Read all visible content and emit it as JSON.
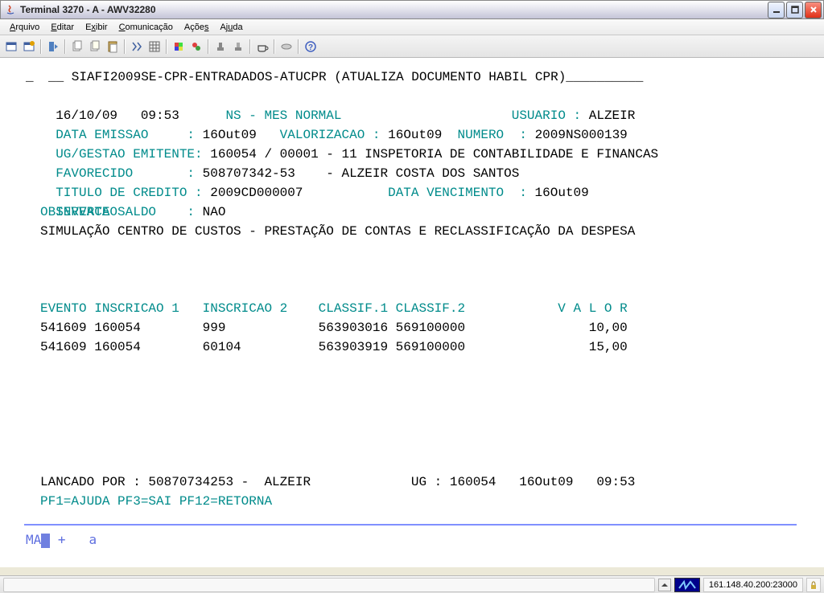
{
  "window": {
    "title": "Terminal 3270 - A - AWV32280"
  },
  "menu": {
    "arquivo": "Arquivo",
    "editar": "Editar",
    "exibir": "Exibir",
    "comunicacao": "Comunicação",
    "acoes": "Ações",
    "ajuda": "Ajuda"
  },
  "screen": {
    "breadcrumb": "__ SIAFI2009SE-CPR-ENTRADADOS-ATUCPR (ATUALIZA DOCUMENTO HABIL CPR)__________",
    "date": "16/10/09",
    "time": "09:53",
    "ns_label": "NS - MES NORMAL",
    "usuario_label": "USUARIO :",
    "usuario_value": "ALZEIR",
    "data_emissao_label": "DATA EMISSAO     :",
    "data_emissao_value": "16Out09",
    "valorizacao_label": "VALORIZACAO :",
    "valorizacao_value": "16Out09",
    "numero_label": "NUMERO  :",
    "numero_value": "2009NS000139",
    "ug_gestao_label": "UG/GESTAO EMITENTE:",
    "ug_gestao_value": "160054 / 00001 - 11 INSPETORIA DE CONTABILIDADE E FINANCAS",
    "favorecido_label": "FAVORECIDO       :",
    "favorecido_value": "508707342-53    - ALZEIR COSTA DOS SANTOS",
    "titulo_label": "TITULO DE CREDITO :",
    "titulo_value": "2009CD000007",
    "data_venc_label": "DATA VENCIMENTO  :",
    "data_venc_value": "16Out09",
    "inverte_label": "INVERTE SALDO    :",
    "inverte_value": "NAO",
    "observacao_label": "OBSERVACAO",
    "observacao_value": "SIMULAÇÃO CENTRO DE CUSTOS - PRESTAÇÃO DE CONTAS E RECLASSIFICAÇÃO DA DESPESA",
    "table_header": "EVENTO INSCRICAO 1   INSCRICAO 2    CLASSIF.1 CLASSIF.2            V A L O R",
    "rows": [
      {
        "line": "541609 160054        999            563903016 569100000                10,00"
      },
      {
        "line": "541609 160054        60104          563903919 569100000                15,00"
      }
    ],
    "lancado_line": "LANCADO POR : 50870734253 -  ALZEIR             UG : 160054   16Out09   09:53",
    "pf_line": "PF1=AJUDA PF3=SAI PF12=RETORNA",
    "status_prefix": "MA",
    "status_suffix": "+   a"
  },
  "statusbar": {
    "address": "161.148.40.200:23000"
  }
}
